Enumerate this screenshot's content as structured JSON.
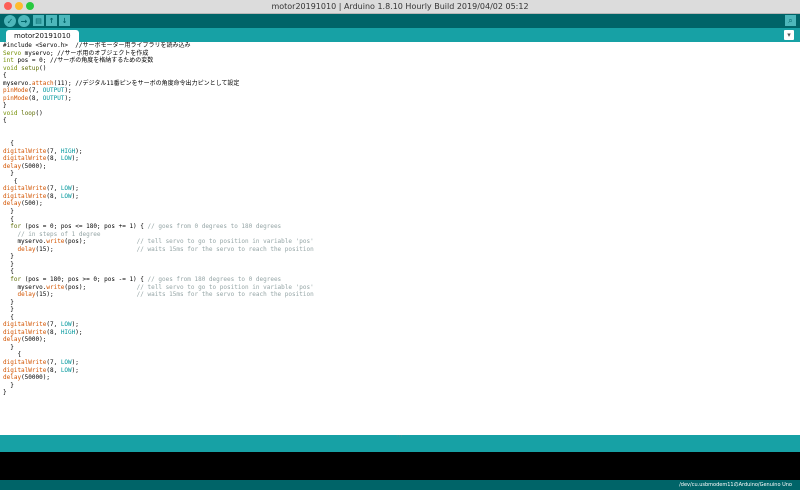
{
  "window": {
    "title": "motor20191010 | Arduino 1.8.10 Hourly Build 2019/04/02 05:12",
    "traffic_lights": {
      "close": "#fd5f57",
      "minimize": "#febb2e",
      "zoom": "#28c940"
    }
  },
  "toolbar": {
    "buttons": [
      {
        "name": "verify-button",
        "icon": "check-icon",
        "glyph": "✓"
      },
      {
        "name": "upload-button",
        "icon": "arrow-right-icon",
        "glyph": "→"
      },
      {
        "name": "new-button",
        "icon": "new-file-icon",
        "glyph": "▤"
      },
      {
        "name": "open-button",
        "icon": "arrow-up-icon",
        "glyph": "↑"
      },
      {
        "name": "save-button",
        "icon": "arrow-down-icon",
        "glyph": "↓"
      }
    ],
    "serial_monitor": {
      "icon": "magnifier-icon",
      "glyph": "⌕"
    }
  },
  "tabs": [
    {
      "label": "motor20191010",
      "active": true
    }
  ],
  "tab_menu": {
    "icon": "menu-icon",
    "glyph": "▾"
  },
  "editor": {
    "lines": [
      [
        [
          "#include <Servo.h>  //サーボモーター用ライブラリを読み込み",
          "t"
        ]
      ],
      [
        [
          "Servo",
          "kg"
        ],
        [
          " myservo; //サーボ用のオブジェクトを作成",
          "t"
        ]
      ],
      [
        [
          "int",
          "kg"
        ],
        [
          " pos = 0; //サーボの角度を格納するための変数",
          "t"
        ]
      ],
      [
        [
          "void",
          "kg"
        ],
        [
          " ",
          "t"
        ],
        [
          "setup",
          "kw"
        ],
        [
          "()",
          "t"
        ]
      ],
      [
        [
          "{",
          "t"
        ]
      ],
      [
        [
          "myservo.",
          "t"
        ],
        [
          "attach",
          "fn"
        ],
        [
          "(11); //デジタル11番ピンをサーボの角度命令出力ピンとして設定",
          "t"
        ]
      ],
      [
        [
          "pinMode",
          "fn"
        ],
        [
          "(7, ",
          "t"
        ],
        [
          "OUTPUT",
          "cn"
        ],
        [
          ");",
          "t"
        ]
      ],
      [
        [
          "pinMode",
          "fn"
        ],
        [
          "(8, ",
          "t"
        ],
        [
          "OUTPUT",
          "cn"
        ],
        [
          ");",
          "t"
        ]
      ],
      [
        [
          "}",
          "t"
        ]
      ],
      [
        [
          "void",
          "kg"
        ],
        [
          " ",
          "t"
        ],
        [
          "loop",
          "kw"
        ],
        [
          "()",
          "t"
        ]
      ],
      [
        [
          "{",
          "t"
        ]
      ],
      [],
      [],
      [
        [
          "  {",
          "t"
        ]
      ],
      [
        [
          "digitalWrite",
          "fn"
        ],
        [
          "(7, ",
          "t"
        ],
        [
          "HIGH",
          "cn"
        ],
        [
          ");",
          "t"
        ]
      ],
      [
        [
          "digitalWrite",
          "fn"
        ],
        [
          "(8, ",
          "t"
        ],
        [
          "LOW",
          "cn"
        ],
        [
          ");",
          "t"
        ]
      ],
      [
        [
          "delay",
          "fn"
        ],
        [
          "(5000);",
          "t"
        ]
      ],
      [
        [
          "  }",
          "t"
        ]
      ],
      [
        [
          "   {",
          "t"
        ]
      ],
      [
        [
          "digitalWrite",
          "fn"
        ],
        [
          "(7, ",
          "t"
        ],
        [
          "LOW",
          "cn"
        ],
        [
          ");",
          "t"
        ]
      ],
      [
        [
          "digitalWrite",
          "fn"
        ],
        [
          "(8, ",
          "t"
        ],
        [
          "LOW",
          "cn"
        ],
        [
          ");",
          "t"
        ]
      ],
      [
        [
          "delay",
          "fn"
        ],
        [
          "(500);",
          "t"
        ]
      ],
      [
        [
          "  }",
          "t"
        ]
      ],
      [
        [
          "  {",
          "t"
        ]
      ],
      [
        [
          "  ",
          "t"
        ],
        [
          "for",
          "kw"
        ],
        [
          " (pos = 0; pos <= 180; pos += 1) { ",
          "t"
        ],
        [
          "// goes from 0 degrees to 180 degrees",
          "cm"
        ]
      ],
      [
        [
          "    ",
          "t"
        ],
        [
          "// in steps of 1 degree",
          "cm"
        ]
      ],
      [
        [
          "    myservo.",
          "t"
        ],
        [
          "write",
          "fn"
        ],
        [
          "(pos);              ",
          "t"
        ],
        [
          "// tell servo to go to position in variable 'pos'",
          "cm"
        ]
      ],
      [
        [
          "    ",
          "t"
        ],
        [
          "delay",
          "fn"
        ],
        [
          "(15);                       ",
          "t"
        ],
        [
          "// waits 15ms for the servo to reach the position",
          "cm"
        ]
      ],
      [
        [
          "  }",
          "t"
        ]
      ],
      [
        [
          "  }",
          "t"
        ]
      ],
      [
        [
          "  {",
          "t"
        ]
      ],
      [
        [
          "  ",
          "t"
        ],
        [
          "for",
          "kw"
        ],
        [
          " (pos = 180; pos >= 0; pos -= 1) { ",
          "t"
        ],
        [
          "// goes from 180 degrees to 0 degrees",
          "cm"
        ]
      ],
      [
        [
          "    myservo.",
          "t"
        ],
        [
          "write",
          "fn"
        ],
        [
          "(pos);              ",
          "t"
        ],
        [
          "// tell servo to go to position in variable 'pos'",
          "cm"
        ]
      ],
      [
        [
          "    ",
          "t"
        ],
        [
          "delay",
          "fn"
        ],
        [
          "(15);                       ",
          "t"
        ],
        [
          "// waits 15ms for the servo to reach the position",
          "cm"
        ]
      ],
      [
        [
          "  }",
          "t"
        ]
      ],
      [
        [
          "  }",
          "t"
        ]
      ],
      [
        [
          "  {",
          "t"
        ]
      ],
      [
        [
          "digitalWrite",
          "fn"
        ],
        [
          "(7, ",
          "t"
        ],
        [
          "LOW",
          "cn"
        ],
        [
          ");",
          "t"
        ]
      ],
      [
        [
          "digitalWrite",
          "fn"
        ],
        [
          "(8, ",
          "t"
        ],
        [
          "HIGH",
          "cn"
        ],
        [
          ");",
          "t"
        ]
      ],
      [
        [
          "delay",
          "fn"
        ],
        [
          "(5000);",
          "t"
        ]
      ],
      [
        [
          "  }",
          "t"
        ]
      ],
      [
        [
          "    {",
          "t"
        ]
      ],
      [
        [
          "digitalWrite",
          "fn"
        ],
        [
          "(7, ",
          "t"
        ],
        [
          "LOW",
          "cn"
        ],
        [
          ");",
          "t"
        ]
      ],
      [
        [
          "digitalWrite",
          "fn"
        ],
        [
          "(8, ",
          "t"
        ],
        [
          "LOW",
          "cn"
        ],
        [
          ");",
          "t"
        ]
      ],
      [
        [
          "delay",
          "fn"
        ],
        [
          "(50000);",
          "t"
        ]
      ],
      [
        [
          "  }",
          "t"
        ]
      ],
      [
        [
          "}",
          "t"
        ]
      ]
    ]
  },
  "divider": {
    "glyph": "⋯"
  },
  "status": {
    "port": "/dev/cu.usbmodem11のArduino/Genuino Uno"
  },
  "colors": {
    "toolbar": "#006468",
    "tabbar": "#17a1a5",
    "button": "#4db7bb"
  }
}
